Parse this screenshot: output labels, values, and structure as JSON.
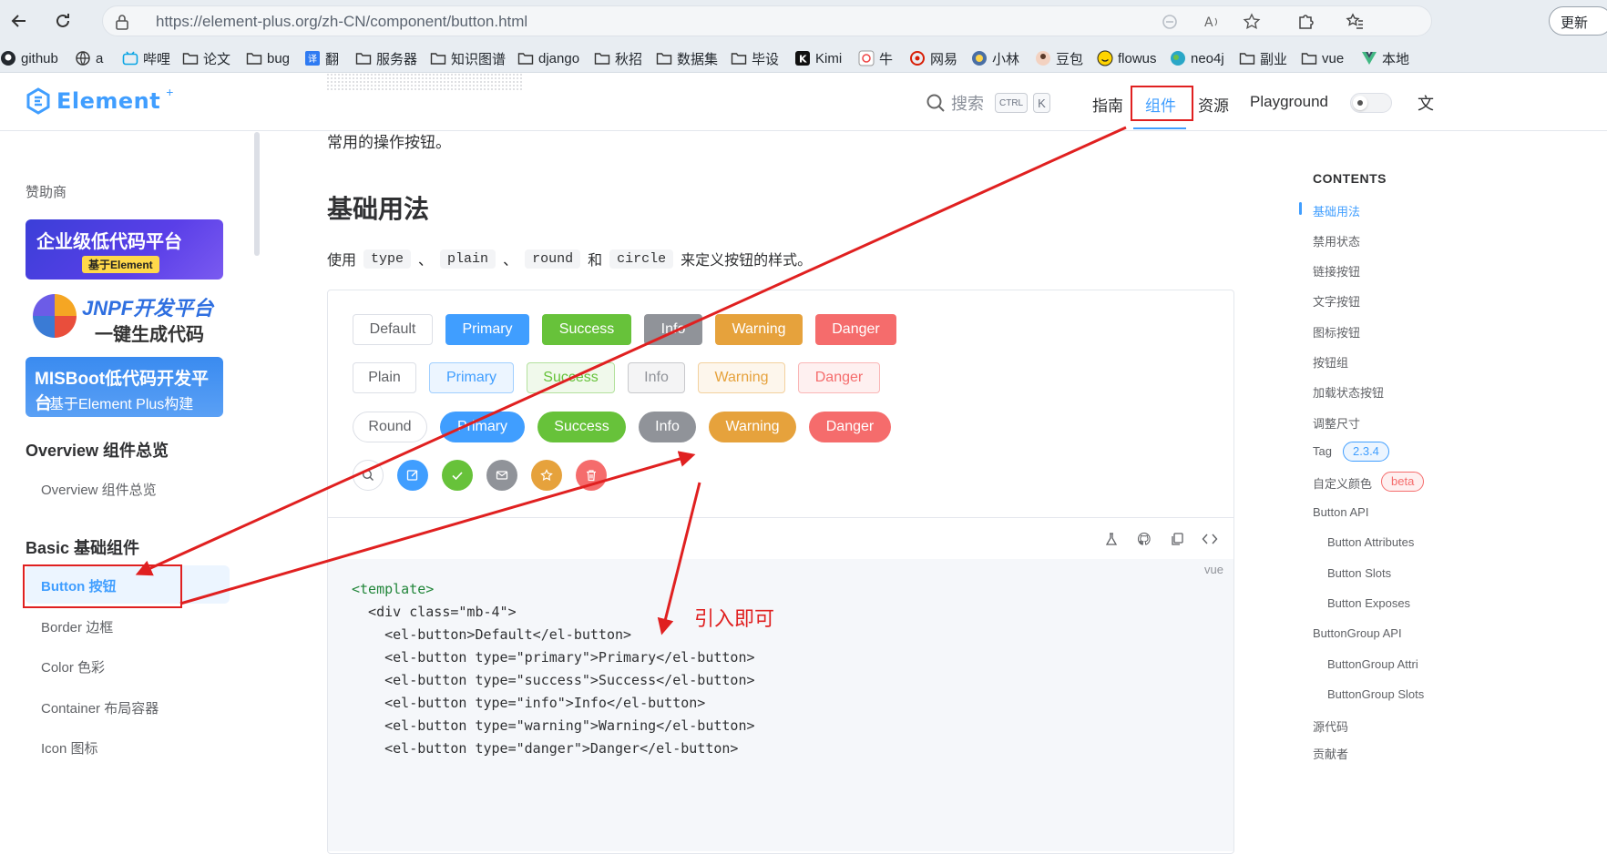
{
  "browser": {
    "url": "https://element-plus.org/zh-CN/component/button.html",
    "update_label": "更新",
    "bookmarks": [
      {
        "label": "github",
        "icon": "github-icon"
      },
      {
        "label": "a",
        "icon": "globe-icon"
      },
      {
        "label": "哔哩",
        "icon": "bilibili-icon"
      },
      {
        "label": "论文",
        "icon": "folder-icon"
      },
      {
        "label": "bug",
        "icon": "folder-icon"
      },
      {
        "label": "翻",
        "icon": "translate-icon"
      },
      {
        "label": "服务器",
        "icon": "folder-icon"
      },
      {
        "label": "知识图谱",
        "icon": "folder-icon"
      },
      {
        "label": "django",
        "icon": "folder-icon"
      },
      {
        "label": "秋招",
        "icon": "folder-icon"
      },
      {
        "label": "数据集",
        "icon": "folder-icon"
      },
      {
        "label": "毕设",
        "icon": "folder-icon"
      },
      {
        "label": "Kimi",
        "icon": "kimi-icon"
      },
      {
        "label": "牛",
        "icon": "nowcoder-icon"
      },
      {
        "label": "网易",
        "icon": "netease-icon"
      },
      {
        "label": "小林",
        "icon": "xiaolin-icon"
      },
      {
        "label": "豆包",
        "icon": "doubao-icon"
      },
      {
        "label": "flowus",
        "icon": "flowus-icon"
      },
      {
        "label": "neo4j",
        "icon": "neo4j-icon"
      },
      {
        "label": "副业",
        "icon": "folder-icon"
      },
      {
        "label": "vue",
        "icon": "folder-icon"
      },
      {
        "label": "本地",
        "icon": "vue-icon"
      }
    ]
  },
  "header": {
    "logo": "Element",
    "logo_plus": "+",
    "search_label": "搜索",
    "kbd_ctrl": "CTRL",
    "kbd_k": "K",
    "nav": {
      "guide": "指南",
      "components": "组件",
      "resources": "资源",
      "playground": "Playground"
    },
    "lang": "文"
  },
  "sidebar": {
    "sponsor_title": "赞助商",
    "ads": {
      "ad1_title": "企业级低代码平台",
      "ad1_tag": "基于Element",
      "ad2_title": "JNPF开发平台",
      "ad2_sub": "一键生成代码",
      "ad3_title": "MISBoot低代码开发平台",
      "ad3_sub": "基于Element Plus构建"
    },
    "overview_group": "Overview 组件总览",
    "overview_item": "Overview 组件总览",
    "basic_group": "Basic 基础组件",
    "items": [
      "Button 按钮",
      "Border 边框",
      "Color 色彩",
      "Container 布局容器",
      "Icon 图标"
    ]
  },
  "main": {
    "intro": "常用的操作按钮。",
    "heading": "基础用法",
    "desc_prefix": "使用",
    "chips": [
      "type",
      "plain",
      "round",
      "circle"
    ],
    "sep1": "、",
    "sep2": "、",
    "and": "和",
    "desc_suffix": "来定义按钮的样式。",
    "rows": {
      "default": [
        "Default",
        "Primary",
        "Success",
        "Info",
        "Warning",
        "Danger"
      ],
      "plain": [
        "Plain",
        "Primary",
        "Success",
        "Info",
        "Warning",
        "Danger"
      ],
      "round": [
        "Round",
        "Primary",
        "Success",
        "Info",
        "Warning",
        "Danger"
      ]
    },
    "circle_icons": [
      "search-icon",
      "edit-icon",
      "check-icon",
      "message-icon",
      "star-icon",
      "delete-icon"
    ],
    "code_lang": "vue",
    "code": [
      "<template>",
      "  <div class=\"mb-4\">",
      "    <el-button>Default</el-button>",
      "    <el-button type=\"primary\">Primary</el-button>",
      "    <el-button type=\"success\">Success</el-button>",
      "    <el-button type=\"info\">Info</el-button>",
      "    <el-button type=\"warning\">Warning</el-button>",
      "    <el-button type=\"danger\">Danger</el-button>"
    ],
    "annotation": "引入即可"
  },
  "toc": {
    "title": "CONTENTS",
    "items": [
      "基础用法",
      "禁用状态",
      "链接按钮",
      "文字按钮",
      "图标按钮",
      "按钮组",
      "加载状态按钮",
      "调整尺寸",
      "Tag",
      "自定义颜色",
      "Button API",
      "Button Attributes",
      "Button Slots",
      "Button Exposes",
      "ButtonGroup API",
      "ButtonGroup Attri",
      "ButtonGroup Slots",
      "源代码",
      "贡献者"
    ],
    "tag_badge": "2.3.4",
    "beta_badge": "beta"
  },
  "colors": {
    "primary": "#409eff",
    "success": "#67c23a",
    "info": "#909399",
    "warning": "#e6a23c",
    "danger": "#f56c6c",
    "annotation": "#e02020"
  }
}
